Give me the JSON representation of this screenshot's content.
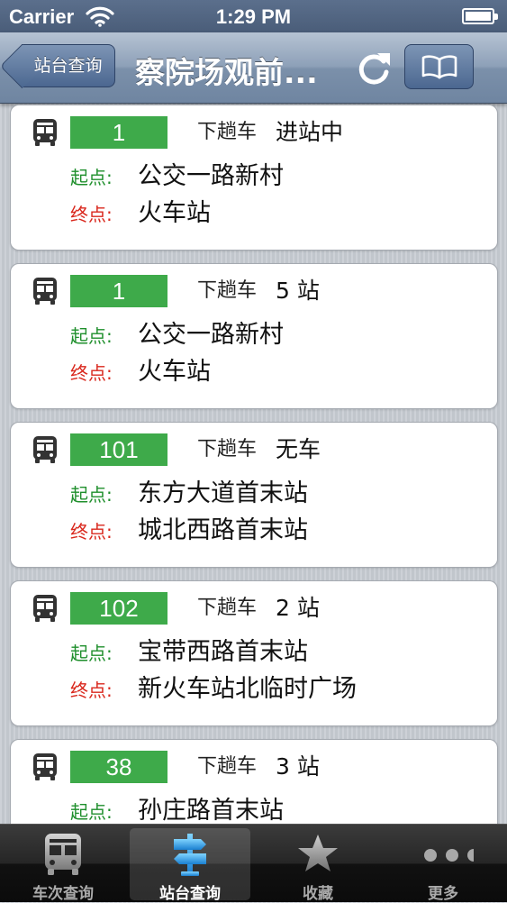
{
  "status_bar": {
    "carrier": "Carrier",
    "time": "1:29 PM"
  },
  "nav": {
    "back_label": "站台查询",
    "title": "察院场观前...",
    "refresh_icon": "refresh-icon",
    "book_icon": "book-icon"
  },
  "labels": {
    "start": "起点:",
    "end": "终点:"
  },
  "routes": [
    {
      "route": "1",
      "direction": "下趟车",
      "status": "进站中",
      "start": "公交一路新村",
      "end": "火车站"
    },
    {
      "route": "1",
      "direction": "下趟车",
      "status": "5 站",
      "start": "公交一路新村",
      "end": "火车站"
    },
    {
      "route": "101",
      "direction": "下趟车",
      "status": "无车",
      "start": "东方大道首末站",
      "end": "城北西路首末站"
    },
    {
      "route": "102",
      "direction": "下趟车",
      "status": "2 站",
      "start": "宝带西路首末站",
      "end": "新火车站北临时广场"
    },
    {
      "route": "38",
      "direction": "下趟车",
      "status": "3 站",
      "start": "孙庄路首末站",
      "end": ""
    }
  ],
  "tabs": [
    {
      "label": "车次查询",
      "icon": "bus-icon"
    },
    {
      "label": "站台查询",
      "icon": "signpost-icon",
      "selected": true
    },
    {
      "label": "收藏",
      "icon": "star-icon"
    },
    {
      "label": "更多",
      "icon": "more-dots-icon"
    }
  ],
  "colors": {
    "badge_green": "#3eaa4a",
    "start_label": "#1f8f2c",
    "end_label": "#d9271c"
  }
}
